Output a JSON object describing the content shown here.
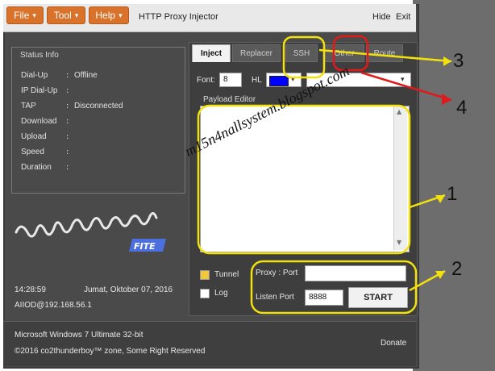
{
  "menus": [
    {
      "label": "File",
      "caret": "▾"
    },
    {
      "label": "Tool",
      "caret": "▾"
    },
    {
      "label": "Help",
      "caret": "▾"
    }
  ],
  "window": {
    "title": "HTTP Proxy Injector",
    "hide": "Hide",
    "exit": "Exit"
  },
  "status": {
    "title": "Status Info",
    "rows": [
      {
        "label": "Dial-Up",
        "value": "Offline"
      },
      {
        "label": "IP Dial-Up",
        "value": ""
      },
      {
        "label": "TAP",
        "value": "Disconnected"
      },
      {
        "label": "Download",
        "value": ""
      },
      {
        "label": "Upload",
        "value": ""
      },
      {
        "label": "Speed",
        "value": ""
      },
      {
        "label": "Duration",
        "value": ""
      }
    ]
  },
  "info": {
    "time": "14:28:59",
    "date": "Jumat, Oktober 07, 2016",
    "host": "AIIOD@192.168.56.1"
  },
  "tabs": [
    "Inject",
    "Replacer",
    "SSH",
    "Other",
    "Route"
  ],
  "editor_controls": {
    "font_label": "Font:",
    "font_value": "8",
    "hl_label": "HL",
    "hl_color": "#0000ff",
    "payload_label": "Payload Editor"
  },
  "options": {
    "tunnel": "Tunnel",
    "log": "Log",
    "proxy_label": "Proxy : Port",
    "proxy_value": "",
    "listen_label": "Listen Port",
    "listen_value": "8888",
    "start": "START"
  },
  "footer": {
    "os": "Microsoft Windows 7 Ultimate  32-bit",
    "copyright": "©2016  co2thunderboy™ zone, Some Right Reserved",
    "donate": "Donate"
  },
  "watermark": "m15n4nallsystem.blogspot.com",
  "annotations": [
    "1",
    "2",
    "3",
    "4"
  ],
  "colors": {
    "menu_orange": "#d9722a",
    "highlight_yellow": "#f2e10d",
    "highlight_red": "#e01a1a"
  }
}
